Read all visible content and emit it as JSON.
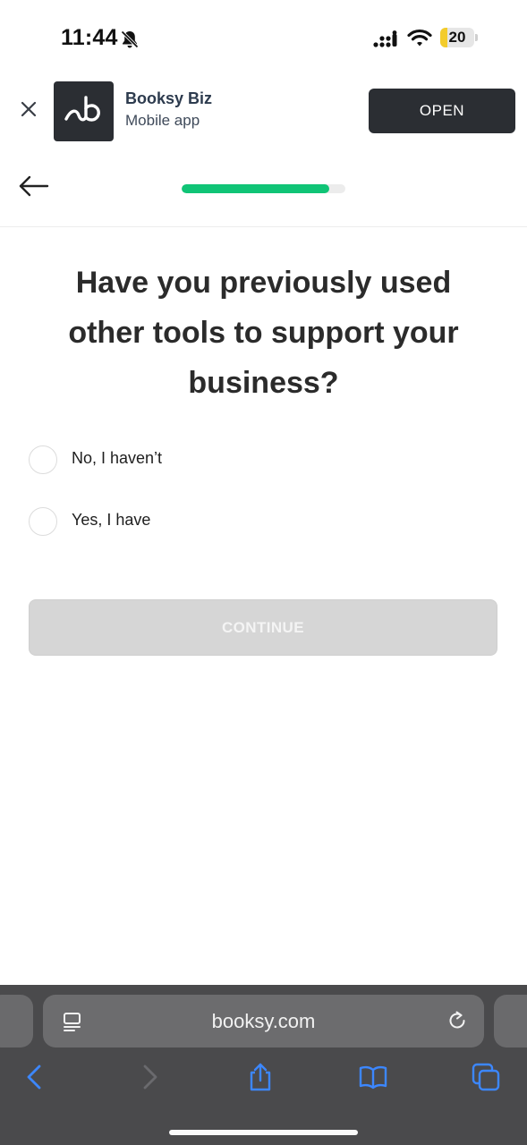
{
  "status_bar": {
    "time": "11:44",
    "battery_level": "20",
    "battery_fraction": 0.2,
    "battery_color": "#f3cc2c",
    "icons": [
      "bell-slash-icon",
      "cellular-signal-icon",
      "wifi-icon",
      "battery-icon"
    ]
  },
  "app_banner": {
    "app_name": "Booksy Biz",
    "app_subtitle": "Mobile app",
    "open_label": "OPEN",
    "icons": [
      "close-icon",
      "booksy-logo"
    ]
  },
  "header": {
    "progress": 0.9,
    "progress_color": "#10c476",
    "icons": [
      "arrow-left-icon"
    ]
  },
  "question": {
    "title": "Have you previously used other tools to support your business?",
    "options": [
      {
        "label": "No, I haven’t",
        "selected": false
      },
      {
        "label": "Yes, I have",
        "selected": false
      }
    ]
  },
  "continue_button": {
    "label": "CONTINUE",
    "enabled": false
  },
  "browser": {
    "address": "booksy.com",
    "icons": [
      "page-menu-icon",
      "reload-icon",
      "back-icon",
      "forward-icon",
      "share-icon",
      "bookmarks-icon",
      "tabs-icon"
    ]
  }
}
